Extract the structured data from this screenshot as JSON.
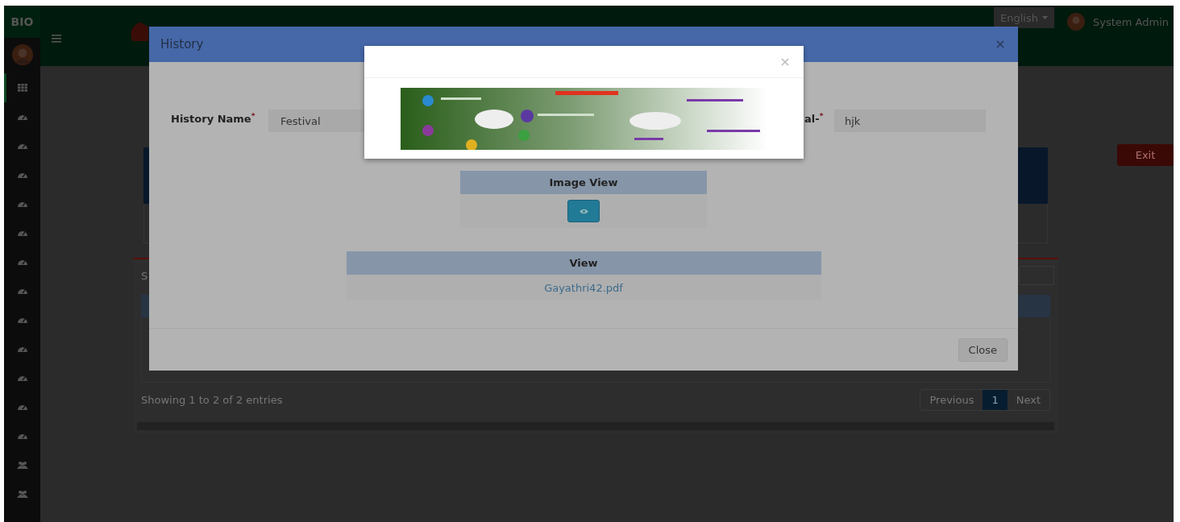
{
  "app": {
    "brand": "BIO",
    "language": "English",
    "user": "System Admin",
    "exit_button": "Exit"
  },
  "sidebar": {
    "items": [
      {
        "kind": "grid",
        "selected": true
      },
      {
        "kind": "gauge",
        "selected": false
      },
      {
        "kind": "gauge",
        "selected": false
      },
      {
        "kind": "gauge",
        "selected": false
      },
      {
        "kind": "gauge",
        "selected": false
      },
      {
        "kind": "gauge",
        "selected": false
      },
      {
        "kind": "gauge",
        "selected": false
      },
      {
        "kind": "gauge",
        "selected": false
      },
      {
        "kind": "gauge",
        "selected": false
      },
      {
        "kind": "gauge",
        "selected": false
      },
      {
        "kind": "gauge",
        "selected": false
      },
      {
        "kind": "gauge",
        "selected": false
      },
      {
        "kind": "gauge",
        "selected": false
      },
      {
        "kind": "users",
        "selected": false
      },
      {
        "kind": "users",
        "selected": false
      }
    ]
  },
  "background_table": {
    "search_label": "S",
    "info": "Showing 1 to 2 of 2 entries",
    "pagination": [
      {
        "label": "Previous",
        "selected": false
      },
      {
        "label": "1",
        "selected": true
      },
      {
        "label": "Next",
        "selected": false
      }
    ]
  },
  "history_modal": {
    "title": "History",
    "required_mark": "*",
    "fields": [
      {
        "label": "History Name",
        "required": true,
        "value": "Festival"
      },
      {
        "label": "al-",
        "required": true,
        "value": "hjk"
      }
    ],
    "image_view": {
      "header": "Image View"
    },
    "view": {
      "header": "View",
      "file": "Gayathri42.pdf"
    },
    "close_button": "Close"
  }
}
